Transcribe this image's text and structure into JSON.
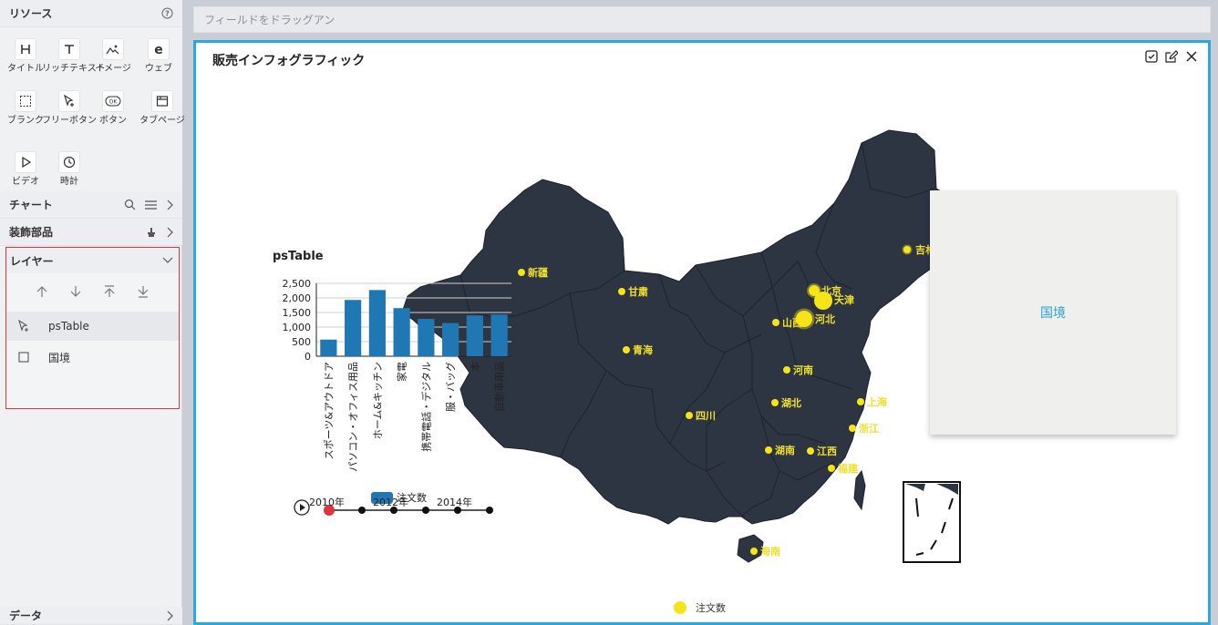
{
  "left_panel": {
    "resources": {
      "title": "リソース",
      "items": [
        {
          "label": "タイトル",
          "icon": "title-H-icon"
        },
        {
          "label": "リッチテキスト",
          "icon": "text-T-icon"
        },
        {
          "label": "イメージ",
          "icon": "image-icon"
        },
        {
          "label": "ウェブ",
          "icon": "web-e-icon"
        },
        {
          "label": "ブランク",
          "icon": "blank-icon"
        },
        {
          "label": "フリーボタン",
          "icon": "free-button-icon"
        },
        {
          "label": "ボタン",
          "icon": "ok-button-icon"
        },
        {
          "label": "タブページ",
          "icon": "tab-page-icon"
        },
        {
          "label": "ビデオ",
          "icon": "video-play-icon"
        },
        {
          "label": "時計",
          "icon": "clock-icon"
        }
      ]
    },
    "chart_section": {
      "title": "チャート"
    },
    "decoration_section": {
      "title": "装飾部品"
    },
    "layer_section": {
      "title": "レイヤー",
      "items": [
        {
          "label": "psTable",
          "icon": "cursor-plus-icon"
        },
        {
          "label": "国境",
          "icon": "square-icon"
        }
      ]
    },
    "data_section": {
      "title": "データ"
    }
  },
  "drop_bar": {
    "placeholder": "フィールドをドラッグアン"
  },
  "canvas": {
    "title": "販売インフォグラフィック",
    "border_panel_label": "国境",
    "map_legend": "注文数",
    "cities": [
      {
        "name": "新疆"
      },
      {
        "name": "甘粛"
      },
      {
        "name": "青海"
      },
      {
        "name": "北京"
      },
      {
        "name": "天津"
      },
      {
        "name": "山西"
      },
      {
        "name": "河北"
      },
      {
        "name": "河南"
      },
      {
        "name": "湖北"
      },
      {
        "name": "上海"
      },
      {
        "name": "四川"
      },
      {
        "name": "浙江"
      },
      {
        "name": "湖南"
      },
      {
        "name": "江西"
      },
      {
        "name": "福建"
      },
      {
        "name": "海南"
      },
      {
        "name": "吉林"
      }
    ]
  },
  "chart_data": {
    "type": "bar",
    "title": "psTable",
    "categories": [
      "スポーツ&アウトドア",
      "パソコン・オフィス用品",
      "ホーム&キッチン",
      "家電",
      "携帯電話・デジタル",
      "服・バッグ",
      "本",
      "自動車用品"
    ],
    "series": [
      {
        "name": "注文数",
        "values": [
          570,
          1930,
          2270,
          1650,
          1280,
          1140,
          1400,
          1430
        ],
        "color": "#1f78b4"
      }
    ],
    "y_ticks": [
      "0",
      "500",
      "1,000",
      "1,500",
      "2,000",
      "2,500"
    ],
    "ylim": [
      0,
      2500
    ],
    "grid": true,
    "legend_position": "bottom"
  },
  "timeline": {
    "labels": [
      "2010年",
      "2012年",
      "2014年"
    ]
  },
  "colors": {
    "accent": "#2aa8e0",
    "map_fill": "#2e3542",
    "city_dot": "#f5e418",
    "bar": "#1f78b4"
  }
}
